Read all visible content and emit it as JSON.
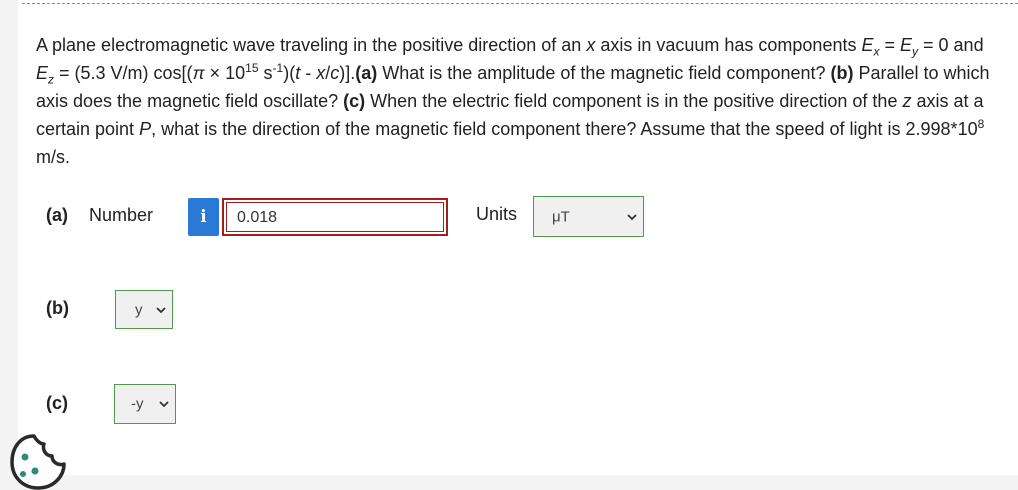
{
  "question": {
    "intro": "A plane electromagnetic wave traveling in the positive direction of an ",
    "x1": "x",
    "mid1": " axis in vacuum has components ",
    "E1": "E",
    "sub_x": "x",
    "eq1": " = ",
    "E2": "E",
    "sub_y": "y",
    "eq2": " = 0 and ",
    "E3": "E",
    "sub_z": "z",
    "eq3": " = (5.3 V/m) cos[(",
    "pi": "π",
    "times": " × 10",
    "exp15": "15",
    "s_unit": " s",
    "exp_neg1": "-1",
    "paren_t": ")(",
    "t": "t",
    "minus": " - ",
    "x2": "x",
    "slash": "/",
    "c": "c",
    "close": ")].",
    "a_label": "(a)",
    "a_text": " What is the amplitude of the magnetic field component? ",
    "b_label": "(b)",
    "b_text": " Parallel to which axis does the magnetic field oscillate? ",
    "c_label": "(c)",
    "c_text1": " When the electric field component is in the positive direction of the ",
    "z": "z",
    "c_text2": " axis at a certain point ",
    "P": "P",
    "c_text3": ", what is the direction of the magnetic field component there? Assume that the speed of light is 2.998*10",
    "exp8": "8",
    "c_text4": " m/s."
  },
  "part_a": {
    "label": "(a)",
    "number_label": "Number",
    "info_icon": "i",
    "answer": "0.018",
    "units_label": "Units",
    "units_value": "μT"
  },
  "part_b": {
    "label": "(b)",
    "value": "y"
  },
  "part_c": {
    "label": "(c)",
    "value": "-y"
  },
  "icons": {
    "chevron": "chevron-down-icon",
    "info": "info-icon",
    "cookie": "cookie-icon"
  },
  "colors": {
    "info_blue": "#2a7ad5",
    "error_red": "#a31d1d",
    "select_border_green": "#4f9a4f"
  }
}
